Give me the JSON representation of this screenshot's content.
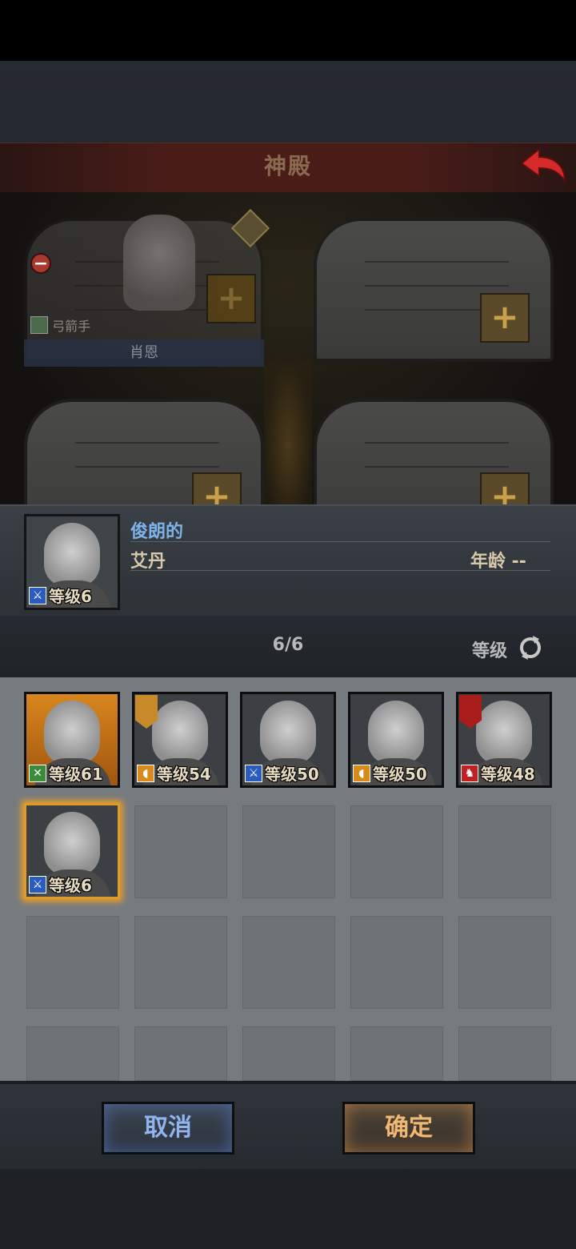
{
  "header": {
    "title": "神殿"
  },
  "temple_slots": {
    "slot1": {
      "class": "弓箭手",
      "name": "肖恩"
    },
    "add_symbol": "+"
  },
  "selected_hero": {
    "adjective": "俊朗的",
    "name": "艾丹",
    "age": "年龄 --",
    "level": "等级6",
    "class_icon": "sword-icon"
  },
  "roster": {
    "count": "6/6",
    "sort_label": "等级",
    "heroes": [
      {
        "level": "等级61",
        "class_icon": "bow-icon",
        "badge_color": "#3a8c3a",
        "background": "#c06a18"
      },
      {
        "level": "等级54",
        "class_icon": "shield-icon",
        "badge_color": "#d88a1c",
        "emblem": "tree-emblem-icon",
        "emblem_color": "#c88a28"
      },
      {
        "level": "等级50",
        "class_icon": "sword-icon",
        "badge_color": "#2a5cc0"
      },
      {
        "level": "等级50",
        "class_icon": "shield-icon",
        "badge_color": "#d88a1c"
      },
      {
        "level": "等级48",
        "class_icon": "horse-icon",
        "badge_color": "#c02020",
        "emblem": "bird-emblem-icon",
        "emblem_color": "#a81c1c"
      },
      {
        "level": "等级6",
        "class_icon": "sword-icon",
        "badge_color": "#2a5cc0",
        "selected": true
      }
    ]
  },
  "buttons": {
    "cancel": "取消",
    "confirm": "确定"
  }
}
